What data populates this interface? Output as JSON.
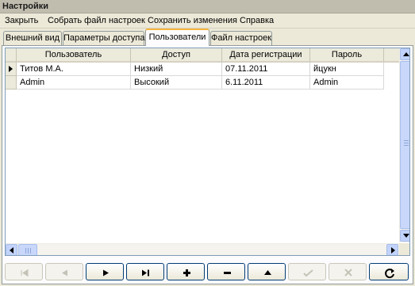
{
  "window": {
    "title": "Настройки"
  },
  "menu": {
    "items": [
      {
        "label": "Закрыть"
      },
      {
        "label": "Собрать файл настроек"
      },
      {
        "label": "Сохранить изменения"
      },
      {
        "label": "Справка"
      }
    ]
  },
  "tabs": [
    {
      "label": "Внешний вид",
      "active": false
    },
    {
      "label": "Параметры доступа",
      "active": false
    },
    {
      "label": "Пользователи",
      "active": true
    },
    {
      "label": "Файл настроек",
      "active": false
    }
  ],
  "grid": {
    "columns": [
      "Пользователь",
      "Доступ",
      "Дата регистрации",
      "Пароль"
    ],
    "rows": [
      {
        "selected": true,
        "cells": [
          "Титов М.А.",
          "Низкий",
          "07.11.2011",
          "йцукн"
        ]
      },
      {
        "selected": false,
        "cells": [
          "Admin",
          "Высокий",
          "6.11.2011",
          "Admin"
        ]
      }
    ]
  },
  "navigator": {
    "buttons": [
      {
        "name": "first-record-icon",
        "enabled": false
      },
      {
        "name": "prior-record-icon",
        "enabled": false
      },
      {
        "name": "next-record-icon",
        "enabled": true
      },
      {
        "name": "last-record-icon",
        "enabled": true
      },
      {
        "name": "insert-record-icon",
        "enabled": true
      },
      {
        "name": "delete-record-icon",
        "enabled": true
      },
      {
        "name": "edit-record-icon",
        "enabled": true
      },
      {
        "name": "post-record-icon",
        "enabled": false
      },
      {
        "name": "cancel-edit-icon",
        "enabled": false
      },
      {
        "name": "refresh-icon",
        "enabled": true
      }
    ]
  }
}
